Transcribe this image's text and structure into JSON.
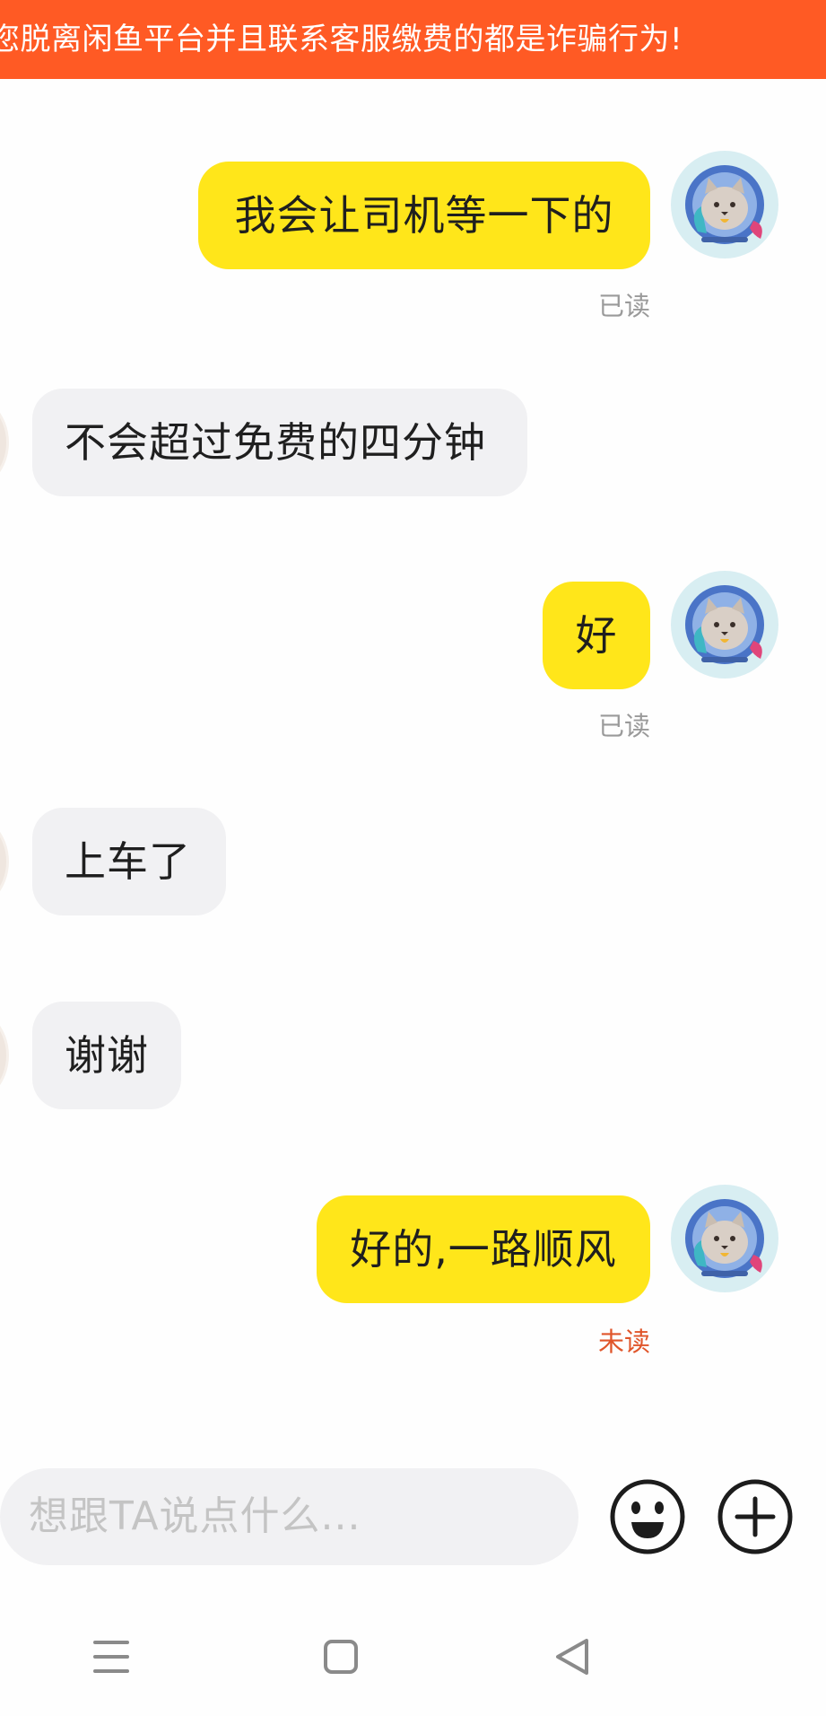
{
  "banner": {
    "text": "您脱离闲鱼平台并且联系客服缴费的都是诈骗行为!"
  },
  "messages": [
    {
      "direction": "out",
      "text": "我会让司机等一下的",
      "status": "已读"
    },
    {
      "direction": "in",
      "text": "不会超过免费的四分钟"
    },
    {
      "direction": "out",
      "text": "好",
      "status": "已读"
    },
    {
      "direction": "in",
      "text": "上车了"
    },
    {
      "direction": "in",
      "text": "谢谢"
    },
    {
      "direction": "out",
      "text": "好的,一路顺风",
      "status": "未读"
    }
  ],
  "input": {
    "placeholder": "想跟TA说点什么..."
  },
  "icons": {
    "emoji": "emoji-icon",
    "plus": "plus-icon",
    "menu": "menu-icon",
    "home": "home-square-icon",
    "back": "back-triangle-icon"
  },
  "colors": {
    "banner_bg": "#ff5a24",
    "outgoing_bubble": "#ffe61a",
    "incoming_bubble": "#f1f1f3",
    "read_status": "#9a9a9a",
    "unread_status": "#e0552a"
  }
}
